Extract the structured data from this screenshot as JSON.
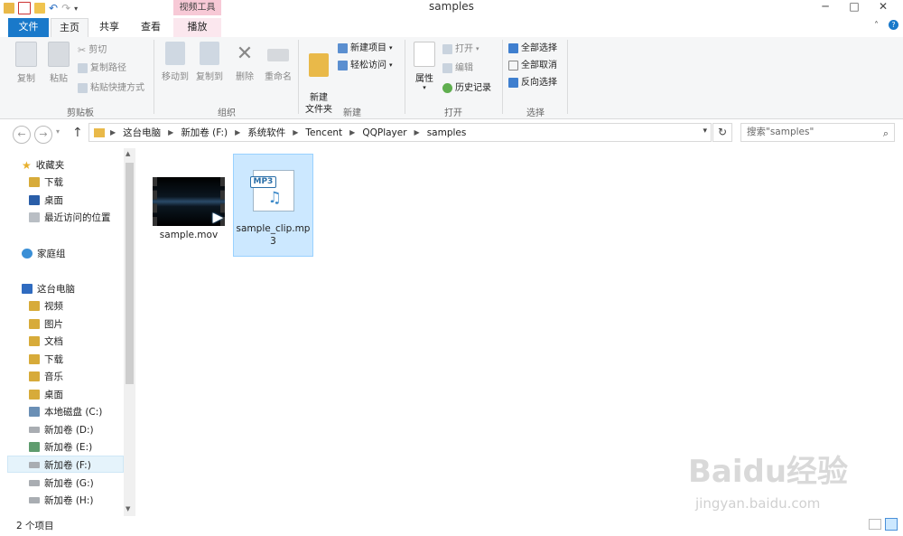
{
  "window": {
    "title": "samples",
    "context_tab_title": "视频工具"
  },
  "tabs": {
    "file": "文件",
    "home": "主页",
    "share": "共享",
    "view": "查看",
    "play": "播放"
  },
  "ribbon": {
    "clipboard": {
      "label": "剪贴板",
      "copy": "复制",
      "paste": "粘贴",
      "cut": "剪切",
      "copy_path": "复制路径",
      "paste_shortcut": "粘贴快捷方式"
    },
    "organize": {
      "label": "组织",
      "move_to": "移动到",
      "copy_to": "复制到",
      "delete": "删除",
      "rename": "重命名"
    },
    "new": {
      "label": "新建",
      "new_folder": "新建\n文件夹",
      "new_item": "新建项目",
      "easy_access": "轻松访问"
    },
    "open": {
      "label": "打开",
      "properties": "属性",
      "open": "打开",
      "edit": "编辑",
      "history": "历史记录"
    },
    "select": {
      "label": "选择",
      "select_all": "全部选择",
      "select_none": "全部取消",
      "invert": "反向选择"
    }
  },
  "address": {
    "crumbs": [
      "这台电脑",
      "新加卷 (F:)",
      "系统软件",
      "Tencent",
      "QQPlayer",
      "samples"
    ]
  },
  "search": {
    "placeholder": "搜索\"samples\""
  },
  "nav": {
    "favorites": "收藏夹",
    "downloads": "下载",
    "desktop": "桌面",
    "recent": "最近访问的位置",
    "homegroup": "家庭组",
    "this_pc": "这台电脑",
    "videos": "视频",
    "pictures": "图片",
    "documents": "文档",
    "downloads2": "下载",
    "music": "音乐",
    "desktop2": "桌面",
    "drive_c": "本地磁盘 (C:)",
    "drive_d": "新加卷 (D:)",
    "drive_e": "新加卷 (E:)",
    "drive_f": "新加卷 (F:)",
    "drive_g": "新加卷 (G:)",
    "drive_h": "新加卷 (H:)"
  },
  "files": [
    {
      "name": "sample.mov",
      "type": "video"
    },
    {
      "name": "sample_clip.mp3",
      "type": "audio",
      "badge": "MP3"
    }
  ],
  "status": {
    "count": "2 个项目"
  },
  "watermark": {
    "brand": "Baidu经验",
    "url": "jingyan.baidu.com"
  },
  "colors": {
    "file_tab": "#1979ca",
    "selection": "#cce8ff",
    "context_tab": "#f7c9d6"
  }
}
